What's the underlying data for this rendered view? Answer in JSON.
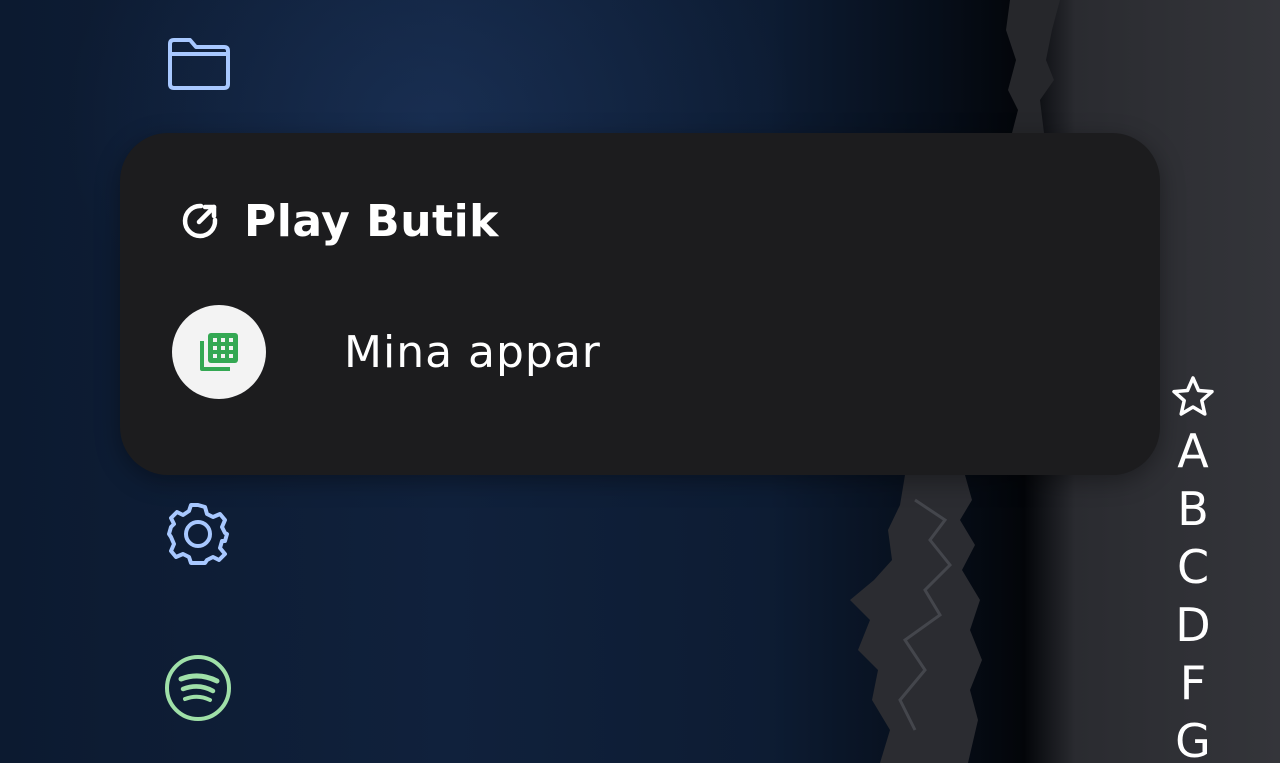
{
  "popup": {
    "title": "Play Butik",
    "header_icon": "open-external-icon",
    "item": {
      "label": "Mina appar",
      "icon": "my-apps-icon",
      "icon_color": "#34a853"
    }
  },
  "dock": {
    "icons": [
      {
        "name": "folder-icon",
        "color": "#a8c8ff"
      },
      {
        "name": "settings-icon",
        "color": "#a8c8ff"
      },
      {
        "name": "spotify-icon",
        "color": "#9fe0a8"
      }
    ]
  },
  "alphabet_index": {
    "favorites_icon": "star-icon",
    "letters": [
      "A",
      "B",
      "C",
      "D",
      "F",
      "G"
    ]
  },
  "colors": {
    "popup_bg": "#1c1c1e",
    "accent_blue": "#a8c8ff",
    "accent_green": "#9fe0a8"
  }
}
